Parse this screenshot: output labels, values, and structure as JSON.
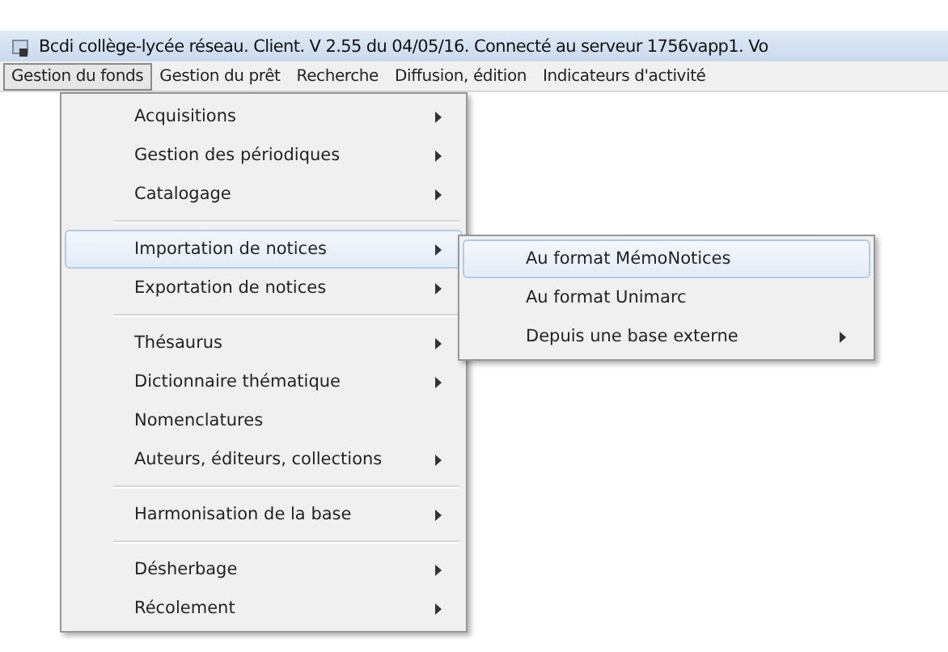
{
  "window": {
    "title": "Bcdi collège-lycée réseau. Client. V 2.55 du 04/05/16. Connecté au serveur 1756vapp1. Vo"
  },
  "menubar": [
    {
      "label": "Gestion du fonds",
      "selected": true
    },
    {
      "label": "Gestion du prêt",
      "selected": false
    },
    {
      "label": "Recherche",
      "selected": false
    },
    {
      "label": "Diffusion, édition",
      "selected": false
    },
    {
      "label": "Indicateurs d'activité",
      "selected": false
    }
  ],
  "menu": {
    "items": [
      {
        "kind": "item",
        "label": "Acquisitions",
        "submenu": true,
        "selected": false
      },
      {
        "kind": "item",
        "label": "Gestion des périodiques",
        "submenu": true,
        "selected": false
      },
      {
        "kind": "item",
        "label": "Catalogage",
        "submenu": true,
        "selected": false
      },
      {
        "kind": "separator"
      },
      {
        "kind": "item",
        "label": "Importation de notices",
        "submenu": true,
        "selected": true
      },
      {
        "kind": "item",
        "label": "Exportation de notices",
        "submenu": true,
        "selected": false
      },
      {
        "kind": "separator"
      },
      {
        "kind": "item",
        "label": "Thésaurus",
        "submenu": true,
        "selected": false
      },
      {
        "kind": "item",
        "label": "Dictionnaire thématique",
        "submenu": true,
        "selected": false
      },
      {
        "kind": "item",
        "label": "Nomenclatures",
        "submenu": false,
        "selected": false
      },
      {
        "kind": "item",
        "label": "Auteurs, éditeurs, collections",
        "submenu": true,
        "selected": false
      },
      {
        "kind": "separator"
      },
      {
        "kind": "item",
        "label": "Harmonisation de la base",
        "submenu": true,
        "selected": false
      },
      {
        "kind": "separator"
      },
      {
        "kind": "item",
        "label": "Désherbage",
        "submenu": true,
        "selected": false
      },
      {
        "kind": "item",
        "label": "Récolement",
        "submenu": true,
        "selected": false
      }
    ]
  },
  "submenu": {
    "items": [
      {
        "kind": "item",
        "label": "Au format MémoNotices",
        "submenu": false,
        "selected": true
      },
      {
        "kind": "item",
        "label": "Au format Unimarc",
        "submenu": false,
        "selected": false
      },
      {
        "kind": "item",
        "label": "Depuis une base externe",
        "submenu": true,
        "selected": false
      }
    ]
  }
}
